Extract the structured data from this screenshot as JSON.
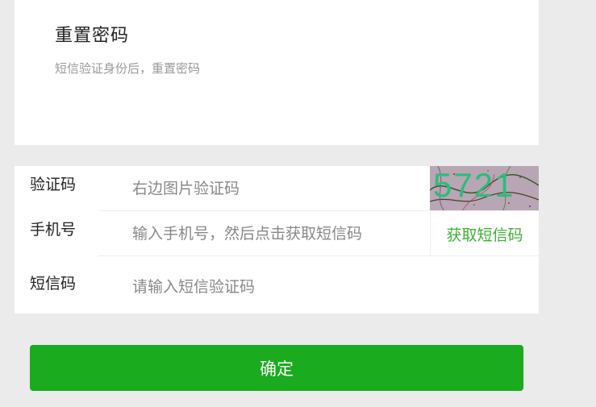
{
  "header": {
    "title": "重置密码",
    "subtitle": "短信验证身份后，重置密码"
  },
  "form": {
    "captcha": {
      "label": "验证码",
      "placeholder": "右边图片验证码",
      "image_text": "5721"
    },
    "phone": {
      "label": "手机号",
      "placeholder": "输入手机号，然后点击获取短信码",
      "button_label": "获取短信码"
    },
    "sms": {
      "label": "短信码",
      "placeholder": "请输入短信验证码"
    }
  },
  "actions": {
    "confirm_label": "确定"
  },
  "colors": {
    "primary": "#1aab1f",
    "link": "#3cb034",
    "background": "#ebebeb"
  }
}
